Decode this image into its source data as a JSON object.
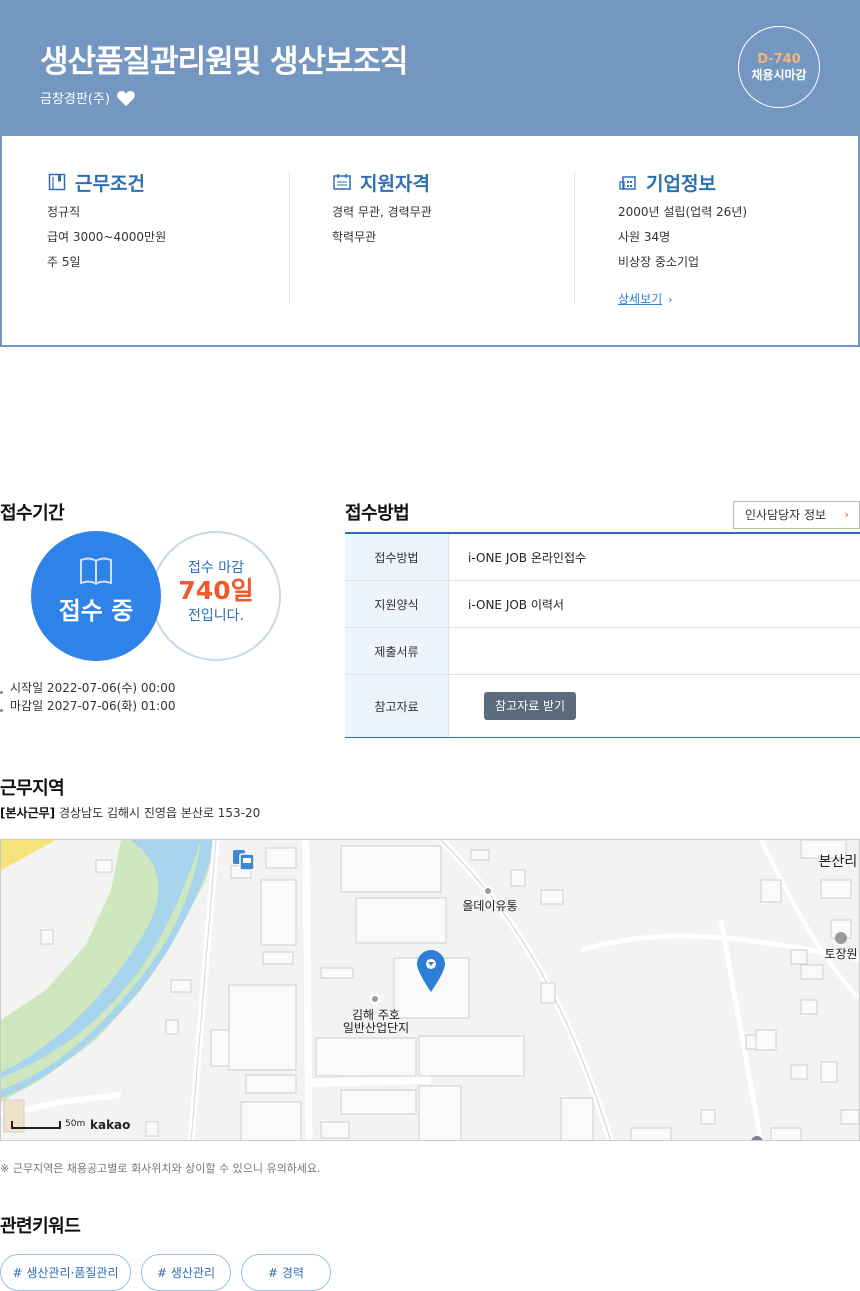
{
  "header": {
    "title": "생산품질관리원및 생산보조직",
    "company": "금창경판(주)",
    "dday": "D-740",
    "deadline_type": "채용시마감"
  },
  "info": {
    "work": {
      "title": "근무조건",
      "lines": [
        "정규직",
        "급여 3000~4000만원",
        "주 5일"
      ]
    },
    "qual": {
      "title": "지원자격",
      "lines": [
        "경력 무관, 경력무관",
        "학력무관"
      ]
    },
    "company": {
      "title": "기업정보",
      "lines": [
        "2000년 설립(업력 26년)",
        "사원 34명",
        "비상장 중소기업"
      ],
      "more": "상세보기"
    }
  },
  "period": {
    "title": "접수기간",
    "status": "접수 중",
    "deadline_label": "접수 마감",
    "days_left": "740일",
    "suffix": "전입니다.",
    "start": "시작일 2022-07-06(수) 00:00",
    "end": "마감일 2027-07-06(화) 01:00"
  },
  "apply": {
    "title": "접수방법",
    "hr_button": "인사담당자 정보",
    "rows": [
      {
        "key": "접수방법",
        "value": "i-ONE JOB 온라인접수"
      },
      {
        "key": "지원양식",
        "value": "i-ONE JOB 이력서"
      },
      {
        "key": "제출서류",
        "value": ""
      },
      {
        "key": "참고자료",
        "button": "참고자료 받기"
      }
    ]
  },
  "location": {
    "title": "근무지역",
    "tag": "[본사근무]",
    "address": "경상남도 김해시 진영읍 본산로 153-20",
    "map_labels": {
      "place1": "올데이유통",
      "place2a": "김해 주호",
      "place2b": "일반산업단지",
      "place3": "토장원",
      "place4": "본산리"
    },
    "scale": "50m",
    "map_brand": "kakao",
    "note": "※ 근무지역은 채용공고별로 회사위치와 상이할 수 있으니 유의하세요."
  },
  "keywords": {
    "title": "관련키워드",
    "items": [
      "# 생산관리·품질관리",
      "# 생산관리",
      "# 경력"
    ]
  },
  "colors": {
    "header_bg": "#7397c1",
    "primary": "#2d83e8",
    "accent": "#f4572a"
  }
}
